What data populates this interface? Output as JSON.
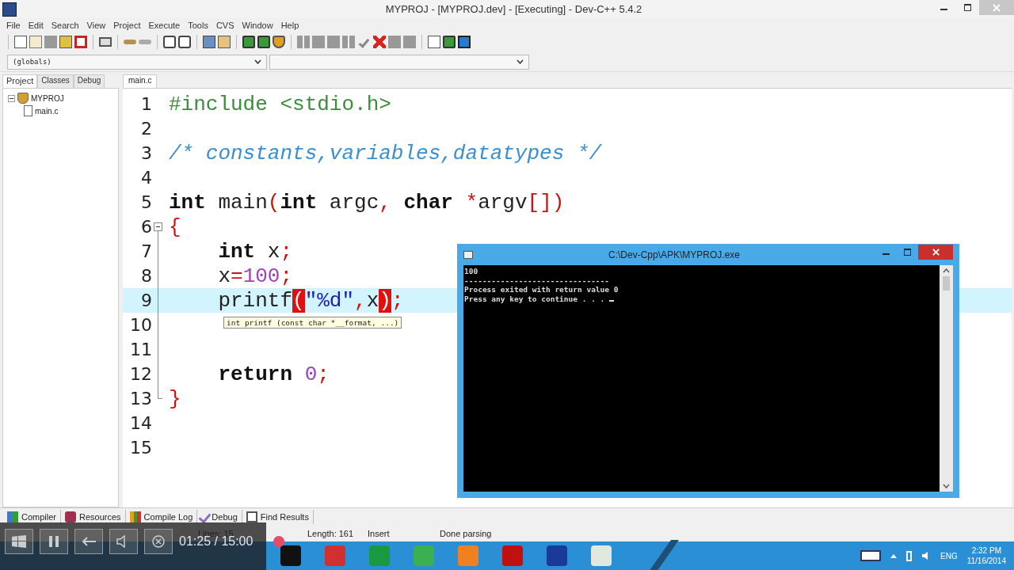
{
  "window": {
    "title": "MYPROJ - [MYPROJ.dev] - [Executing] - Dev-C++ 5.4.2"
  },
  "menu": [
    "File",
    "Edit",
    "Search",
    "View",
    "Project",
    "Execute",
    "Tools",
    "CVS",
    "Window",
    "Help"
  ],
  "scope_combo": {
    "value": "(globals)"
  },
  "left_tabs": [
    {
      "label": "Project",
      "selected": true
    },
    {
      "label": "Classes",
      "selected": false
    },
    {
      "label": "Debug",
      "selected": false
    }
  ],
  "project_tree": [
    {
      "label": "MYPROJ",
      "expanded": true,
      "children": [
        {
          "label": "main.c"
        }
      ]
    }
  ],
  "editor_tabs": [
    {
      "label": "main.c",
      "selected": true
    }
  ],
  "code_lines": [
    {
      "number": "1",
      "current": false,
      "tokens": [
        {
          "kind": "preproc",
          "text": "#include <stdio.h>"
        }
      ]
    },
    {
      "number": "2",
      "current": false
    },
    {
      "number": "3",
      "current": false,
      "tokens": [
        {
          "kind": "comment",
          "text": "/* constants,variables,datatypes */"
        }
      ]
    },
    {
      "number": "4",
      "current": false
    },
    {
      "number": "5",
      "current": false,
      "tokens": [
        {
          "kind": "keyword",
          "text": "int"
        },
        {
          "kind": "plain",
          "text": " main"
        },
        {
          "kind": "symbol",
          "text": "("
        },
        {
          "kind": "keyword",
          "text": "int"
        },
        {
          "kind": "plain",
          "text": " argc"
        },
        {
          "kind": "symbol",
          "text": ", "
        },
        {
          "kind": "keyword",
          "text": "char"
        },
        {
          "kind": "symbol",
          "text": " *"
        },
        {
          "kind": "plain",
          "text": "argv"
        },
        {
          "kind": "symbol",
          "text": "[])"
        }
      ]
    },
    {
      "number": "6",
      "current": false,
      "fold_start": true,
      "tokens": [
        {
          "kind": "symbol",
          "text": "{"
        }
      ]
    },
    {
      "number": "7",
      "current": false,
      "tokens": [
        {
          "kind": "keyword",
          "text": "    int"
        },
        {
          "kind": "plain",
          "text": " x"
        },
        {
          "kind": "symbol",
          "text": ";"
        }
      ]
    },
    {
      "number": "8",
      "current": false,
      "tokens": [
        {
          "kind": "plain",
          "text": "    x"
        },
        {
          "kind": "symbol",
          "text": "="
        },
        {
          "kind": "number",
          "text": "100"
        },
        {
          "kind": "symbol",
          "text": ";"
        }
      ]
    },
    {
      "number": "9",
      "current": true,
      "tokens": [
        {
          "kind": "plain",
          "text": "    printf"
        },
        {
          "kind": "match",
          "text": "("
        },
        {
          "kind": "string",
          "text": "\"%d\""
        },
        {
          "kind": "symbol",
          "text": ","
        },
        {
          "kind": "plain",
          "text": "x"
        },
        {
          "kind": "match",
          "text": ")"
        },
        {
          "kind": "symbol",
          "text": ";"
        }
      ]
    },
    {
      "number": "10",
      "current": false
    },
    {
      "number": "11",
      "current": false
    },
    {
      "number": "12",
      "current": false,
      "tokens": [
        {
          "kind": "keyword",
          "text": "    return"
        },
        {
          "kind": "number",
          "text": " 0"
        },
        {
          "kind": "symbol",
          "text": ";"
        }
      ]
    },
    {
      "number": "13",
      "current": false,
      "fold_end": true,
      "tokens": [
        {
          "kind": "symbol",
          "text": "}"
        }
      ]
    },
    {
      "number": "14",
      "current": false
    },
    {
      "number": "15",
      "current": false
    }
  ],
  "tooltip": "int printf (const char *__format, ...)",
  "console": {
    "title": "C:\\Dev-Cpp\\APK\\MYPROJ.exe",
    "lines": [
      "100",
      "--------------------------------",
      "Process exited with return value 0",
      "Press any key to continue . . . "
    ]
  },
  "bottom_tabs": [
    "Compiler",
    "Resources",
    "Compile Log",
    "Debug",
    "Find Results"
  ],
  "status_bar": [
    "Lines: 15",
    "Length: 161",
    "Insert",
    "Done parsing"
  ],
  "video_player": {
    "time": "01:25 / 15:00"
  },
  "taskbar": {
    "language": "ENG",
    "clock_time": "2:32 PM",
    "clock_date": "11/16/2014"
  }
}
